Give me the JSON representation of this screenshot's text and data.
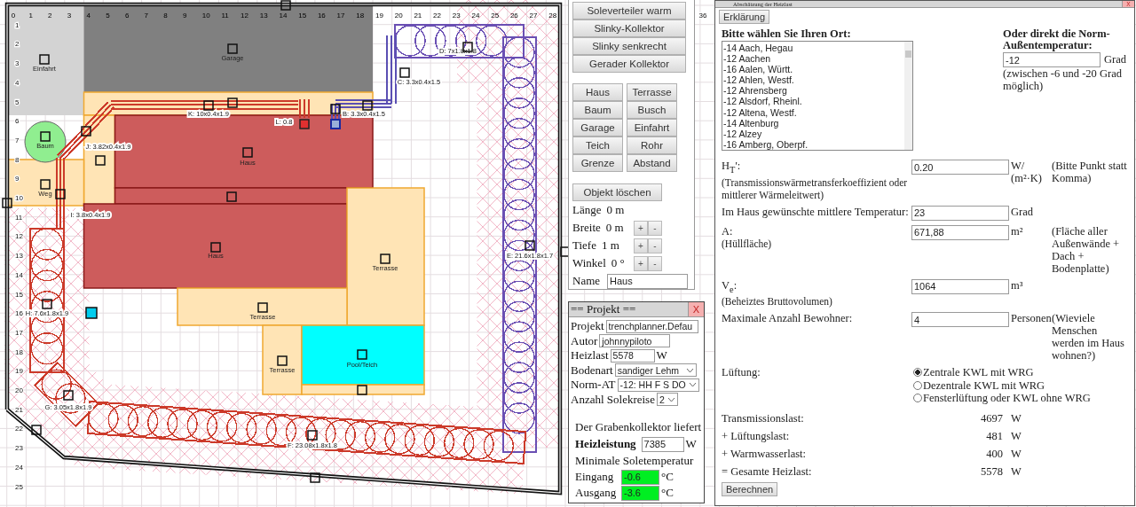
{
  "canvas": {
    "x_labels": [
      "0",
      "1",
      "2",
      "3",
      "4",
      "5",
      "6",
      "7",
      "8",
      "9",
      "10",
      "11",
      "12",
      "13",
      "14",
      "15",
      "16",
      "17",
      "18",
      "19",
      "20",
      "21",
      "22",
      "23",
      "24",
      "25",
      "26",
      "27",
      "28"
    ],
    "x_far_label": "36",
    "y_labels": [
      "1",
      "2",
      "3",
      "4",
      "5",
      "6",
      "7",
      "8",
      "9",
      "10",
      "11",
      "12",
      "13",
      "14",
      "15",
      "16",
      "17",
      "18",
      "19",
      "20",
      "21",
      "22",
      "23",
      "24",
      "25"
    ],
    "objects": [
      {
        "kind": "driveway",
        "label": "Einfahrt"
      },
      {
        "kind": "garage",
        "label": "Garage"
      },
      {
        "kind": "terrace"
      },
      {
        "kind": "terrace"
      },
      {
        "kind": "path",
        "label": "Weg"
      },
      {
        "kind": "house",
        "label": "Haus"
      },
      {
        "kind": "house"
      },
      {
        "kind": "house",
        "label": "Haus"
      },
      {
        "kind": "terrace",
        "label": "Terrasse"
      },
      {
        "kind": "terrace",
        "label": "Terrasse"
      },
      {
        "kind": "terrace",
        "label": "Terrasse"
      },
      {
        "kind": "pond",
        "label": "Pool/Teich"
      },
      {
        "kind": "terrace"
      },
      {
        "kind": "tree",
        "label": "Baum"
      }
    ],
    "trenches": [
      {
        "kind": "slinky",
        "label": "D: 7x1.8x1.8",
        "color": "#6a4fb3"
      },
      {
        "kind": "straight",
        "label": "C: 3.3x0.4x1.5",
        "color": "#5a4fb3"
      },
      {
        "kind": "straight",
        "label": "K: 10x0.4x1.9",
        "color": "#cc3a2a"
      },
      {
        "kind": "straight",
        "label": "L: 0.8",
        "color": "#cc3a2a"
      },
      {
        "kind": "straight",
        "label": "B: 3.3x0.4x1.5",
        "color": "#5a4fb3"
      },
      {
        "kind": "straight",
        "label": "J: 3.82x0.4x1.9",
        "color": "#cc3a2a"
      },
      {
        "kind": "straight",
        "label": "I: 3.8x0.4x1.9",
        "color": "#cc3a2a"
      },
      {
        "kind": "slinky",
        "label": "E: 21.6x1.8x1.7",
        "color": "#6a4fb3"
      },
      {
        "kind": "slinky",
        "label": "H: 7.6x1.8x1.9",
        "color": "#cc3a2a"
      },
      {
        "kind": "slinky",
        "label": "G: 3.05x1.8x1.9",
        "color": "#cc3a2a"
      },
      {
        "kind": "slinky",
        "label": "F: 23.08x1.8x1.8",
        "color": "#cc3a2a"
      }
    ]
  },
  "tool_panel": {
    "collector_buttons": [
      "Soleverteiler warm",
      "Slinky-Kollektor",
      "Slinky senkrecht",
      "Gerader Kollektor"
    ],
    "object_buttons": [
      "Haus",
      "Terrasse",
      "Baum",
      "Busch",
      "Garage",
      "Einfahrt",
      "Teich",
      "Rohr",
      "Grenze",
      "Abstand"
    ],
    "delete_button": "Objekt löschen",
    "fields": [
      {
        "label": "Länge",
        "value": "0 m"
      },
      {
        "label": "Breite",
        "value": "0 m",
        "plus": "+",
        "minus": "-"
      },
      {
        "label": "Tiefe",
        "value": "1 m",
        "plus": "+",
        "minus": "-"
      },
      {
        "label": "Winkel",
        "value": "0 °",
        "plus": "+",
        "minus": "-"
      }
    ],
    "name": {
      "label": "Name",
      "value": "Haus"
    }
  },
  "project_panel": {
    "title": "== Projekt ==",
    "close": "X",
    "fields": [
      {
        "kind": "input",
        "label": "Projekt",
        "value": "trenchplanner.Defau"
      },
      {
        "kind": "input",
        "label": "Autor",
        "value": "johnnypiloto"
      },
      {
        "kind": "input",
        "label": "Heizlast",
        "value": "5578",
        "unit": "W"
      },
      {
        "kind": "select",
        "label": "Bodenart",
        "value": "sandiger Lehm"
      },
      {
        "kind": "select",
        "label": "Norm-AT",
        "value": "-12: HH F S DO"
      },
      {
        "kind": "select",
        "label": "Anzahl Solekreise",
        "value": "2"
      }
    ],
    "result_intro": "Der Grabenkollektor liefert",
    "power": {
      "label": "Heizleistung",
      "value": "7385",
      "unit": "W"
    },
    "min_temp_title": "Minimale Soletemperatur",
    "temps": [
      {
        "label": "Eingang",
        "value": "-0.6",
        "unit": "°C",
        "valid": true
      },
      {
        "label": "Ausgang",
        "value": "-3.6",
        "unit": "°C",
        "valid": true
      }
    ]
  },
  "heat_panel": {
    "title": "Abschätzung der Heizlast",
    "close": "X",
    "help_button": "Erklärung",
    "location_label": "Bitte wählen Sie Ihren Ort:",
    "locations": [
      "-14 Aach, Hegau",
      "-12 Aachen",
      "-16 Aalen, Württ.",
      "-12 Ahlen, Westf.",
      "-12 Ahrensberg",
      "-12 Alsdorf, Rheinl.",
      "-12 Altena, Westf.",
      "-14 Altenburg",
      "-12 Alzey",
      "-16 Amberg, Oberpf."
    ],
    "direct_label": "Oder direkt die Norm-Außentemperatur:",
    "direct_value": "-12",
    "direct_unit": "Grad",
    "direct_hint": "(zwischen -6 und -20 Grad möglich)",
    "rows": [
      {
        "label": "H$_{T}$':",
        "sublabel": "(Transmissionswärmetransferkoeffizient oder mittlerer Wärmeleitwert)",
        "value": "0.20",
        "unit": "W/ (m²·K)",
        "note": "(Bitte Punkt statt Komma)"
      },
      {
        "label": "Im Haus gewünschte mittlere Temperatur:",
        "value": "23",
        "unit": "Grad"
      },
      {
        "label": "A:",
        "sublabel": "(Hüllfläche)",
        "value": "671,88",
        "unit": "m²",
        "note": "(Fläche aller Außenwände + Dach + Bodenplatte)"
      },
      {
        "label": "V$_{e}$:",
        "sublabel": "(Beheiztes Bruttovolumen)",
        "value": "1064",
        "unit": "m³"
      },
      {
        "label": "Maximale Anzahl Bewohner:",
        "value": "4",
        "unit": "Personen",
        "note": "(Wieviele Menschen werden im Haus wohnen?)"
      }
    ],
    "ventilation": {
      "label": "Lüftung:",
      "options": [
        {
          "label": "Zentrale KWL mit WRG",
          "selected": true
        },
        {
          "label": "Dezentrale KWL mit WRG",
          "selected": false
        },
        {
          "label": "Fensterlüftung oder KWL ohne WRG",
          "selected": false
        }
      ]
    },
    "results": [
      {
        "label": "Transmissionslast:",
        "value": "4697",
        "unit": "W"
      },
      {
        "label": "+ Lüftungslast:",
        "value": "481",
        "unit": "W"
      },
      {
        "label": "+ Warmwasserlast:",
        "value": "400",
        "unit": "W"
      },
      {
        "label": "= Gesamte Heizlast:",
        "value": "5578",
        "unit": "W"
      }
    ],
    "calc_button": "Berechnen"
  }
}
